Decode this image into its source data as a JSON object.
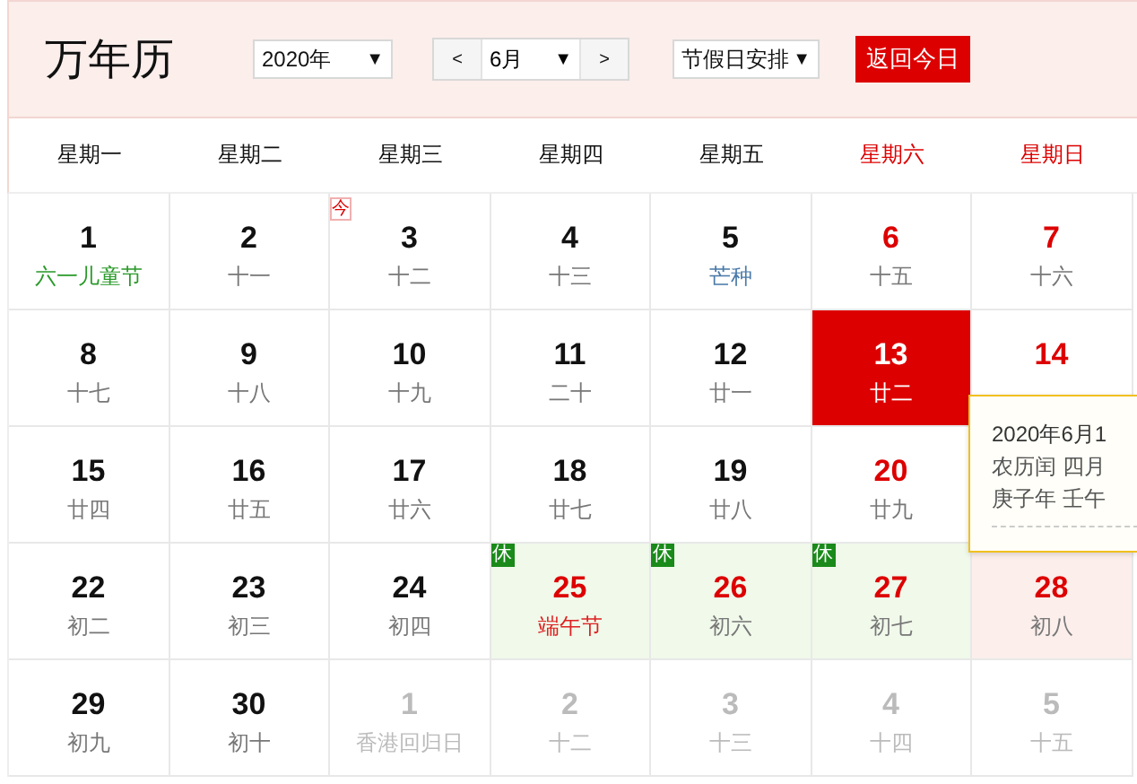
{
  "title": "万年历",
  "controls": {
    "year": "2020年",
    "prev": "<",
    "month": "6月",
    "next": ">",
    "holiday_menu": "节假日安排",
    "today_button": "返回今日",
    "caret": "▼"
  },
  "weekdays": [
    {
      "label": "星期一",
      "weekend": false
    },
    {
      "label": "星期二",
      "weekend": false
    },
    {
      "label": "星期三",
      "weekend": false
    },
    {
      "label": "星期四",
      "weekend": false
    },
    {
      "label": "星期五",
      "weekend": false
    },
    {
      "label": "星期六",
      "weekend": true
    },
    {
      "label": "星期日",
      "weekend": true
    }
  ],
  "weeks": [
    [
      {
        "day": "1",
        "lunar": "六一儿童节",
        "kind": "festival",
        "other_month": false,
        "weekend": false,
        "selected": false,
        "hovered": false
      },
      {
        "day": "2",
        "lunar": "十一",
        "kind": "plain",
        "other_month": false,
        "weekend": false,
        "selected": false,
        "hovered": false
      },
      {
        "day": "3",
        "lunar": "十二",
        "kind": "plain",
        "other_month": false,
        "weekend": false,
        "selected": false,
        "hovered": false,
        "badge": "今"
      },
      {
        "day": "4",
        "lunar": "十三",
        "kind": "plain",
        "other_month": false,
        "weekend": false,
        "selected": false,
        "hovered": false
      },
      {
        "day": "5",
        "lunar": "芒种",
        "kind": "term",
        "other_month": false,
        "weekend": false,
        "selected": false,
        "hovered": false
      },
      {
        "day": "6",
        "lunar": "十五",
        "kind": "plain",
        "other_month": false,
        "weekend": true,
        "selected": false,
        "hovered": false
      },
      {
        "day": "7",
        "lunar": "十六",
        "kind": "plain",
        "other_month": false,
        "weekend": true,
        "selected": false,
        "hovered": false
      }
    ],
    [
      {
        "day": "8",
        "lunar": "十七",
        "kind": "plain",
        "other_month": false,
        "weekend": false,
        "selected": false,
        "hovered": false
      },
      {
        "day": "9",
        "lunar": "十八",
        "kind": "plain",
        "other_month": false,
        "weekend": false,
        "selected": false,
        "hovered": false
      },
      {
        "day": "10",
        "lunar": "十九",
        "kind": "plain",
        "other_month": false,
        "weekend": false,
        "selected": false,
        "hovered": false
      },
      {
        "day": "11",
        "lunar": "二十",
        "kind": "plain",
        "other_month": false,
        "weekend": false,
        "selected": false,
        "hovered": false
      },
      {
        "day": "12",
        "lunar": "廿一",
        "kind": "plain",
        "other_month": false,
        "weekend": false,
        "selected": false,
        "hovered": false
      },
      {
        "day": "13",
        "lunar": "廿二",
        "selected": true,
        "hovered": false
      },
      {
        "day": "14",
        "other_month": false,
        "weekend": true,
        "selected": false,
        "hovered": false
      }
    ],
    [
      {
        "day": "15",
        "lunar": "廿四",
        "kind": "plain",
        "other_month": false,
        "weekend": false,
        "selected": false,
        "hovered": false
      },
      {
        "day": "16",
        "lunar": "廿五",
        "kind": "plain",
        "other_month": false,
        "weekend": false,
        "selected": false,
        "hovered": false
      },
      {
        "day": "17",
        "lunar": "廿六",
        "kind": "plain",
        "other_month": false,
        "weekend": false,
        "selected": false,
        "hovered": false
      },
      {
        "day": "18",
        "lunar": "廿七",
        "kind": "plain",
        "other_month": false,
        "weekend": false,
        "selected": false,
        "hovered": false
      },
      {
        "day": "19",
        "lunar": "廿八",
        "kind": "plain",
        "other_month": false,
        "weekend": false,
        "selected": false,
        "hovered": false
      },
      {
        "day": "20",
        "lunar": "廿九",
        "kind": "plain",
        "other_month": false,
        "weekend": true,
        "selected": false,
        "hovered": false
      }
    ],
    [
      {
        "day": "22",
        "lunar": "初二",
        "kind": "plain",
        "other_month": false,
        "weekend": false,
        "selected": false,
        "hovered": false
      },
      {
        "day": "23",
        "lunar": "初三",
        "kind": "plain",
        "other_month": false,
        "weekend": false,
        "selected": false,
        "hovered": false
      },
      {
        "day": "24",
        "lunar": "初四",
        "kind": "plain",
        "other_month": false,
        "weekend": false,
        "selected": false,
        "hovered": false
      },
      {
        "day": "25",
        "lunar": "端午节",
        "kind": "holiday",
        "other_month": false,
        "weekend": true,
        "selected": false,
        "hovered": false,
        "rest": "休"
      },
      {
        "day": "26",
        "lunar": "初六",
        "kind": "plain",
        "other_month": false,
        "weekend": true,
        "selected": false,
        "hovered": false,
        "rest": "休"
      },
      {
        "day": "27",
        "lunar": "初七",
        "kind": "plain",
        "other_month": false,
        "weekend": true,
        "selected": false,
        "hovered": false,
        "rest": "休"
      },
      {
        "day": "28",
        "lunar": "初八",
        "kind": "plain",
        "other_month": false,
        "weekend": true,
        "selected": false,
        "hovered": true
      }
    ],
    [
      {
        "day": "29",
        "lunar": "初九",
        "kind": "plain",
        "other_month": false,
        "weekend": false,
        "selected": false,
        "hovered": false
      },
      {
        "day": "30",
        "lunar": "初十",
        "kind": "plain",
        "other_month": false,
        "weekend": false,
        "selected": false,
        "hovered": false
      },
      {
        "day": "1",
        "lunar": "香港回归日",
        "other_month": true,
        "selected": false,
        "hovered": false
      },
      {
        "day": "2",
        "lunar": "十二",
        "other_month": true,
        "selected": false,
        "hovered": false
      },
      {
        "day": "3",
        "lunar": "十三",
        "other_month": true,
        "selected": false,
        "hovered": false
      },
      {
        "day": "4",
        "lunar": "十四",
        "other_month": true,
        "selected": false,
        "hovered": false
      },
      {
        "day": "5",
        "lunar": "十五",
        "other_month": true,
        "selected": false,
        "hovered": false
      }
    ]
  ],
  "tooltip": [
    "2020年6月1",
    "农历闰 四月",
    "庚子年 壬午"
  ]
}
